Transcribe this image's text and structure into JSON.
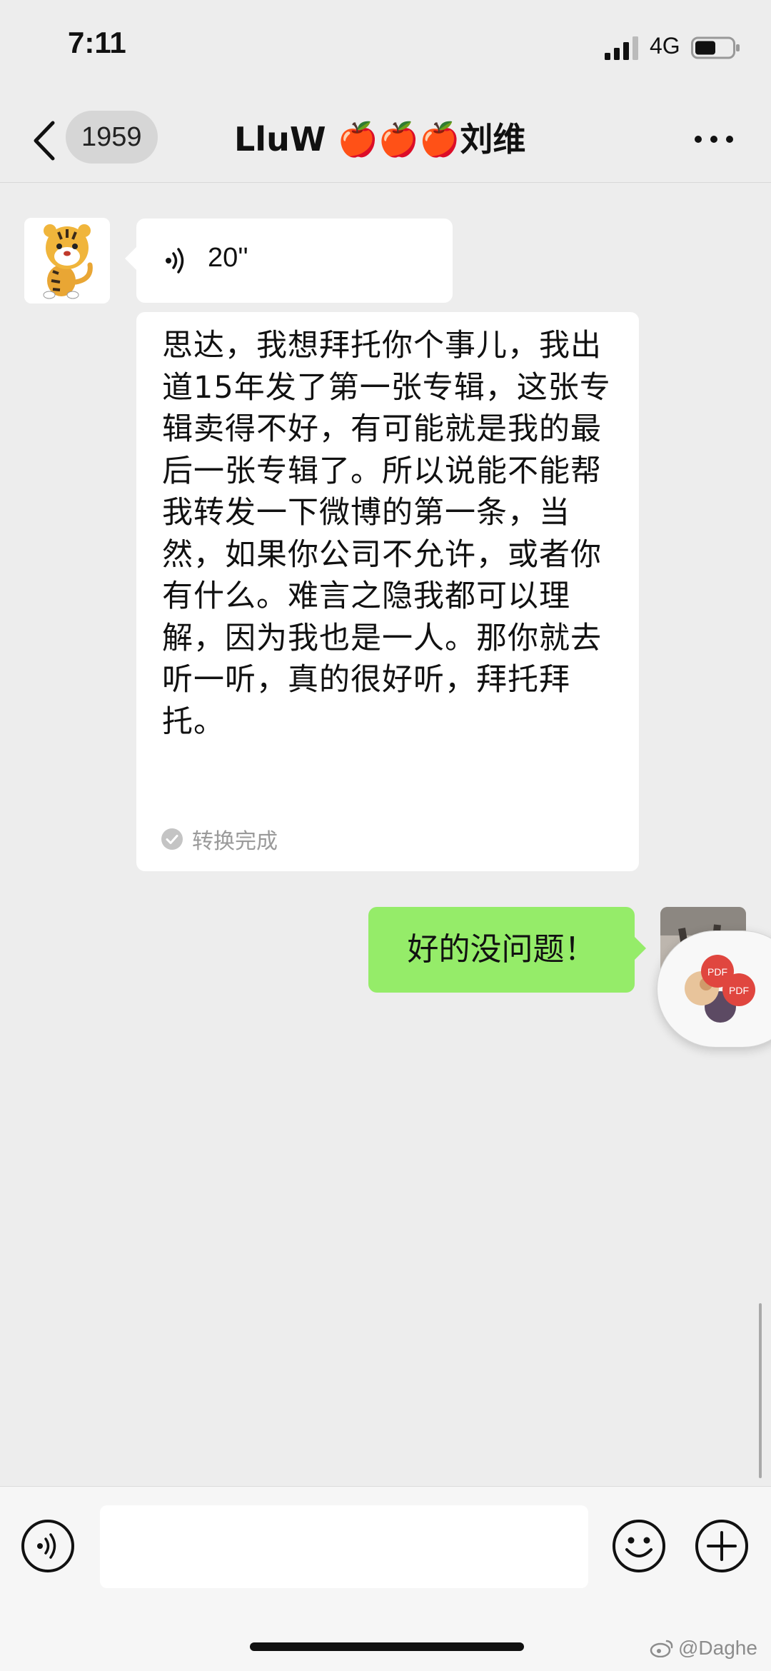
{
  "status_bar": {
    "time": "7:11",
    "network": "4G"
  },
  "nav": {
    "unread_count": "1959",
    "title": "LluW 🍎🍎🍎刘维"
  },
  "messages": {
    "received_voice": {
      "duration": "20''"
    },
    "transcript": {
      "text": "思达，我想拜托你个事儿，我出道15年发了第一张专辑，这张专辑卖得不好，有可能就是我的最后一张专辑了。所以说能不能帮我转发一下微博的第一条，当然，如果你公司不允许，或者你有什么。难言之隐我都可以理解，因为我也是一人。那你就去听一听，真的很好听，拜托拜托。",
      "status": "转换完成"
    },
    "sent_text": "好的没问题！"
  },
  "floating_window": {
    "label_1": "PDF",
    "label_2": "PDF"
  },
  "input_bar": {
    "placeholder": ""
  },
  "watermark": "@Daghe",
  "colors": {
    "background": "#ededed",
    "sent_bubble": "#95ec69",
    "received_bubble": "#ffffff"
  }
}
